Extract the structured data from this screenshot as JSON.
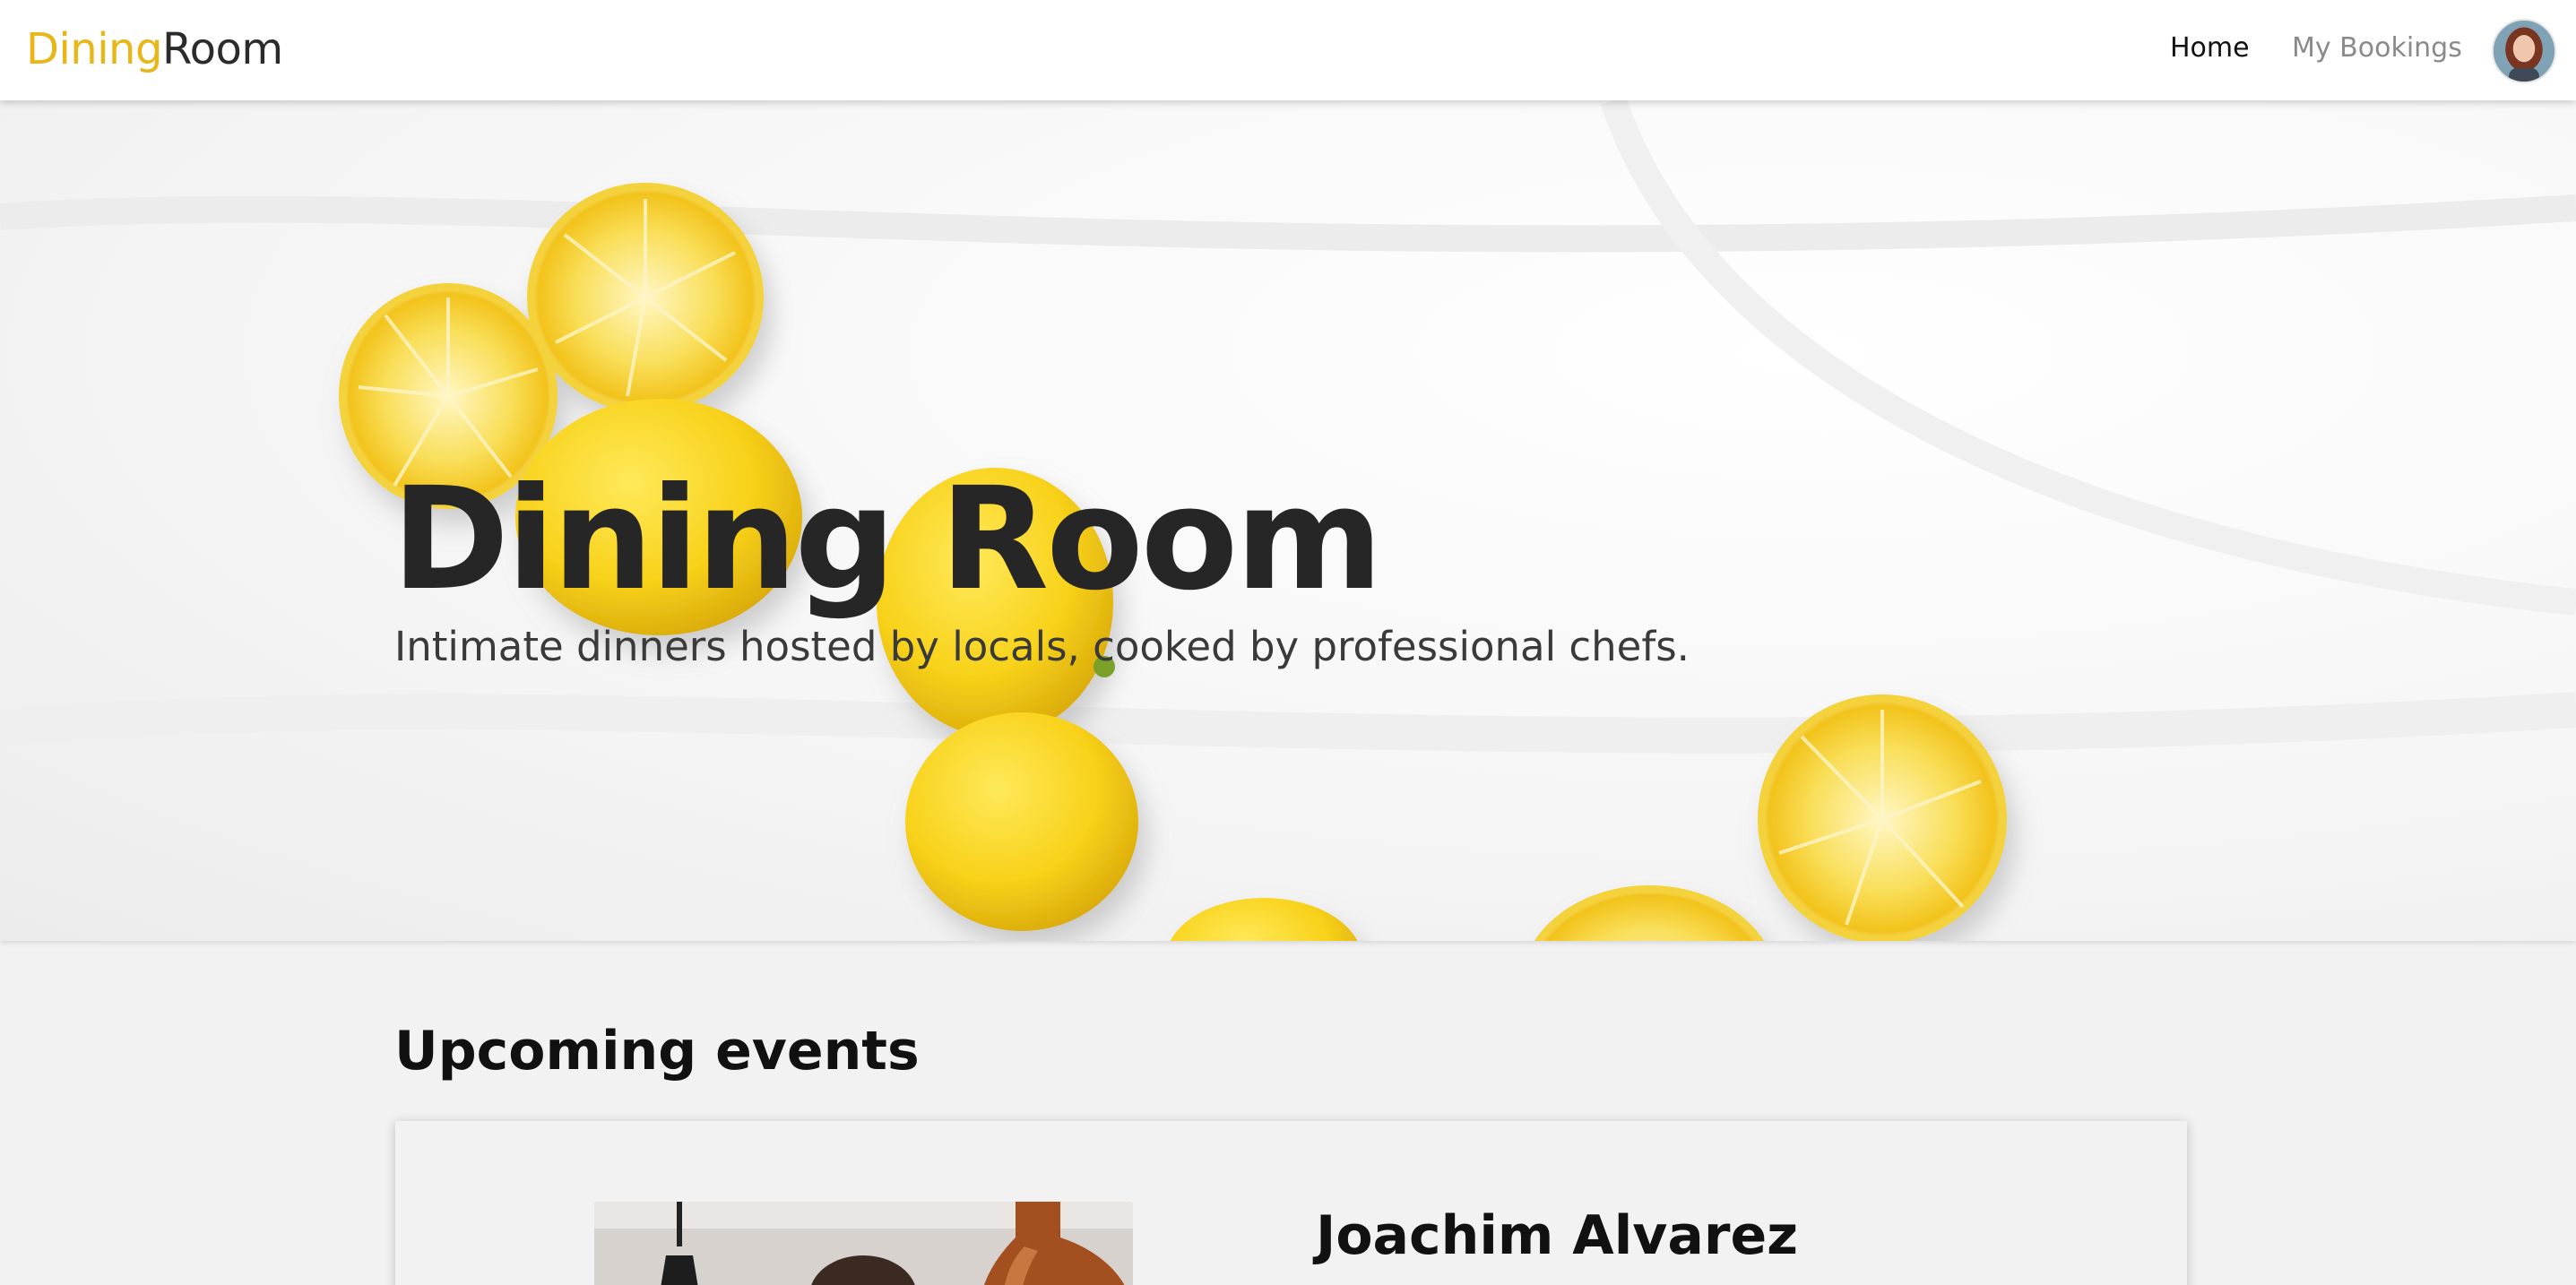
{
  "navbar": {
    "brand_first": "Dining",
    "brand_second": "Room",
    "links": [
      {
        "label": "Home",
        "active": true
      },
      {
        "label": "My Bookings",
        "active": false
      }
    ],
    "avatar_icon": "user-avatar-icon"
  },
  "hero": {
    "title": "Dining Room",
    "subtitle": "Intimate dinners hosted by locals, cooked by professional chefs.",
    "image": "lemons-on-white-cloth"
  },
  "events": {
    "section_title": "Upcoming events",
    "items": [
      {
        "host": "Joachim Alvarez",
        "image": "chef-in-kitchen-photo"
      }
    ]
  },
  "colors": {
    "brand_accent": "#e8b717",
    "text_dark": "#262626",
    "nav_inactive": "#8a8a8a",
    "page_bg": "#f3f2f2"
  }
}
